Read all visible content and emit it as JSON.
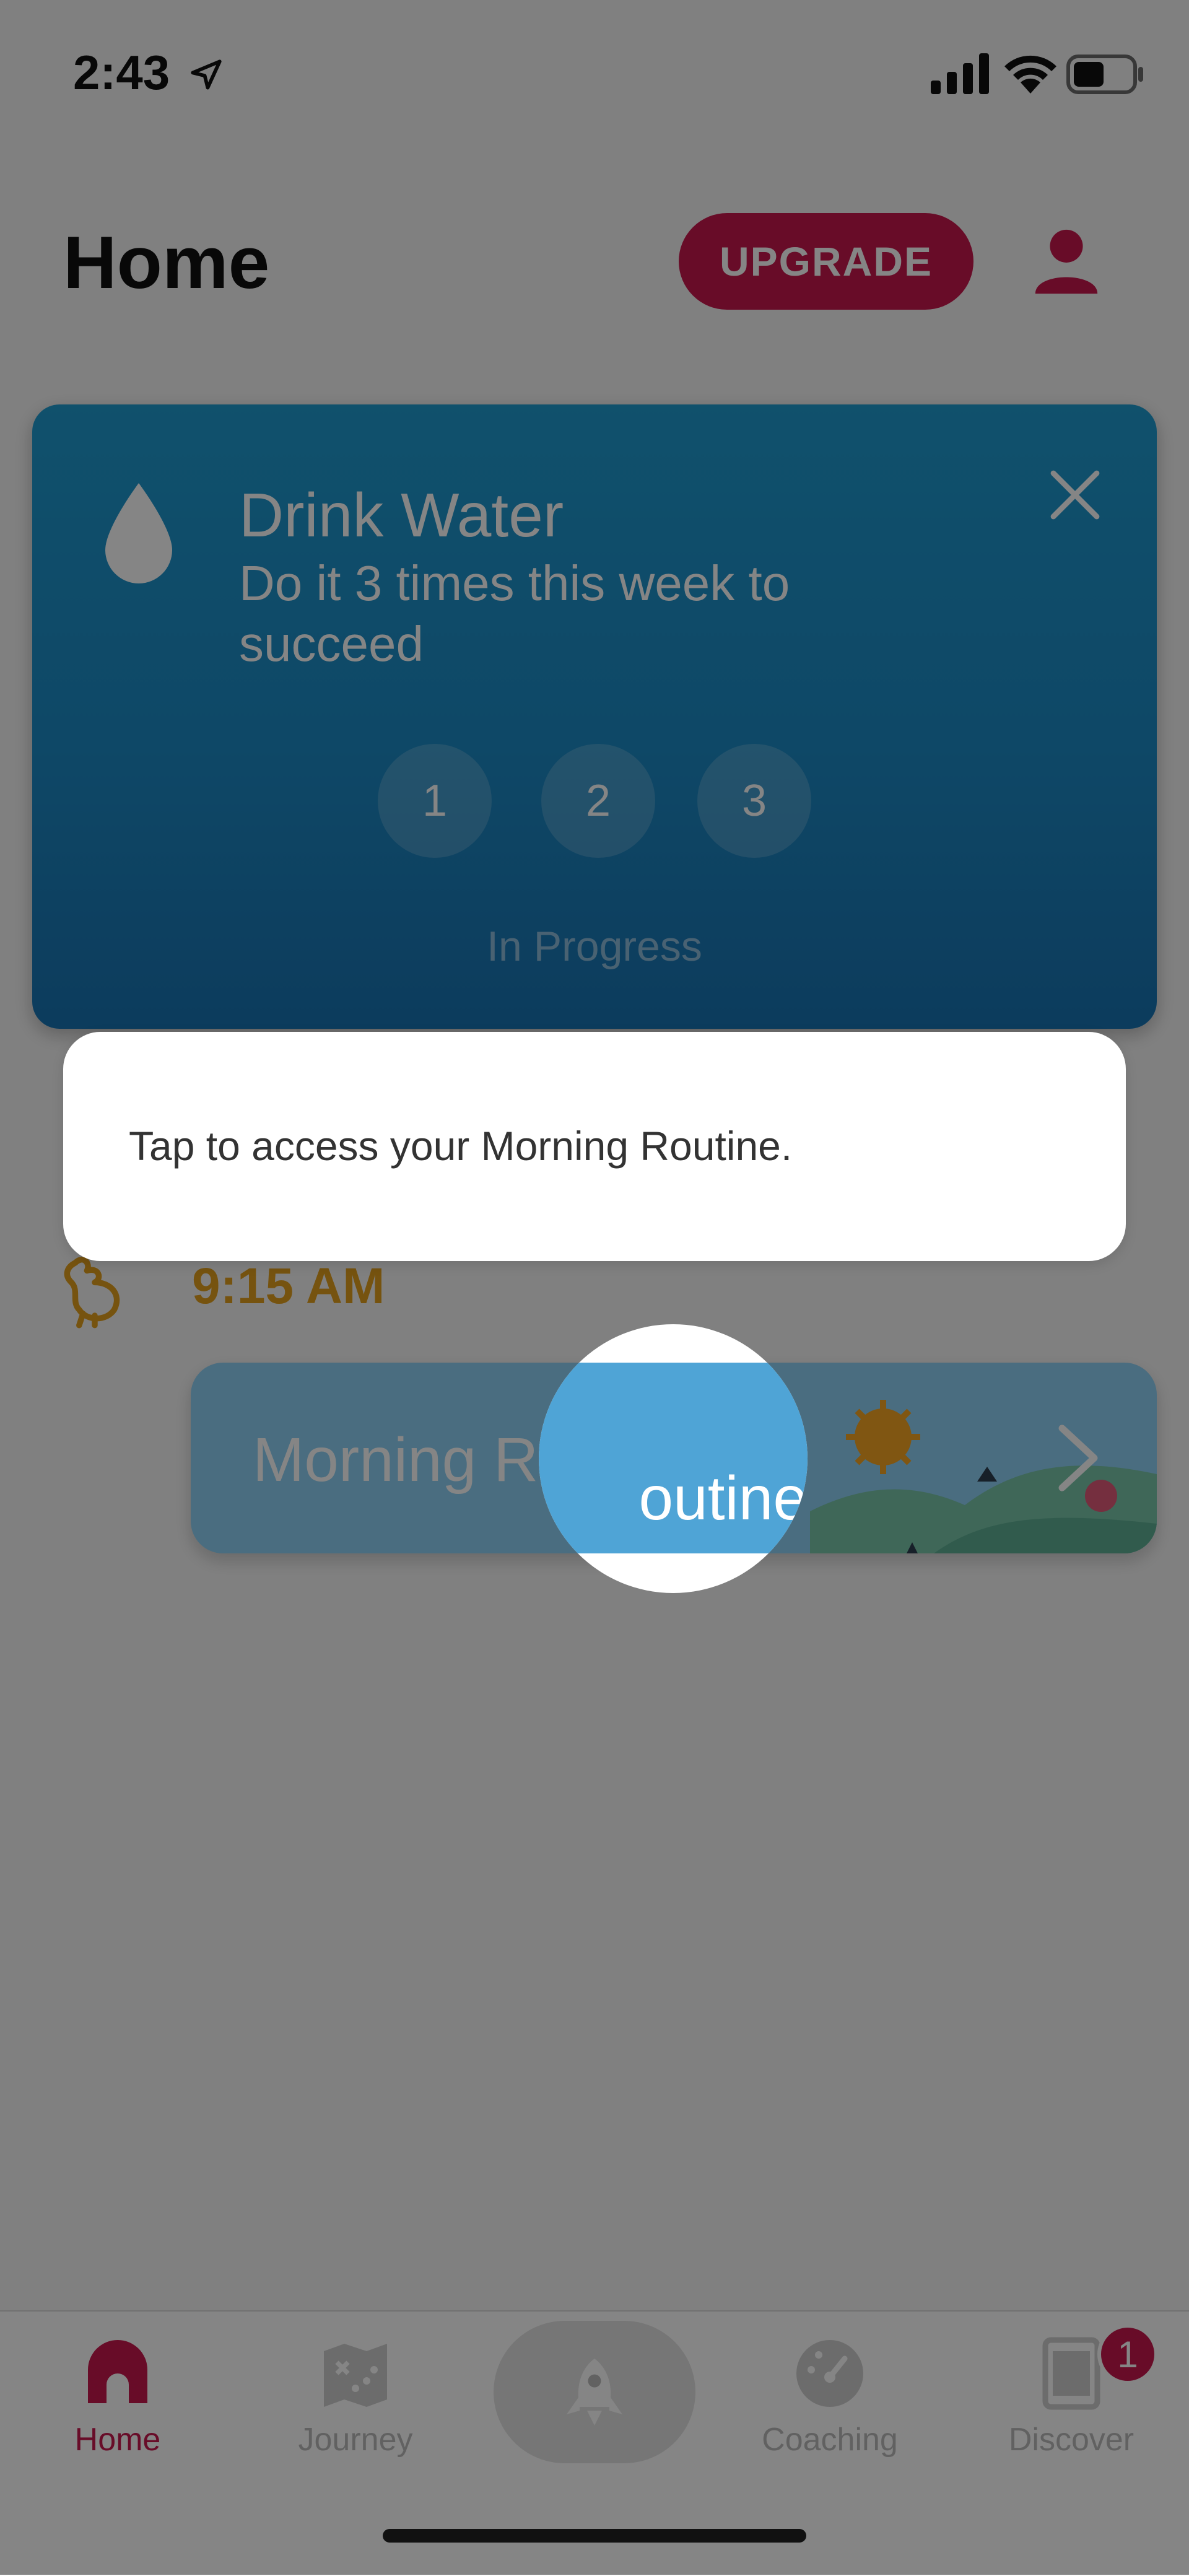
{
  "status_bar": {
    "time": "2:43"
  },
  "header": {
    "title": "Home",
    "upgrade_label": "UPGRADE"
  },
  "challenge": {
    "title": "Drink Water",
    "subtitle": "Do it 3 times this week to succeed",
    "steps": [
      "1",
      "2",
      "3"
    ],
    "status": "In Progress"
  },
  "tooltip": {
    "text": "Tap to access your Morning Routine."
  },
  "routine": {
    "time": "9:15 AM",
    "title": "Morning Routine",
    "spot_text": "outine"
  },
  "tabs": [
    {
      "label": "Home",
      "icon": "home-icon",
      "active": true
    },
    {
      "label": "Journey",
      "icon": "map-icon",
      "active": false
    },
    {
      "label": "",
      "icon": "rocket-icon",
      "active": false
    },
    {
      "label": "Coaching",
      "icon": "gauge-icon",
      "active": false
    },
    {
      "label": "Discover",
      "icon": "tablet-icon",
      "active": false,
      "badge": "1"
    }
  ],
  "colors": {
    "accent": "#c8174d",
    "card_blue": "#1c8ac5",
    "time_yellow": "#e3a01e"
  }
}
